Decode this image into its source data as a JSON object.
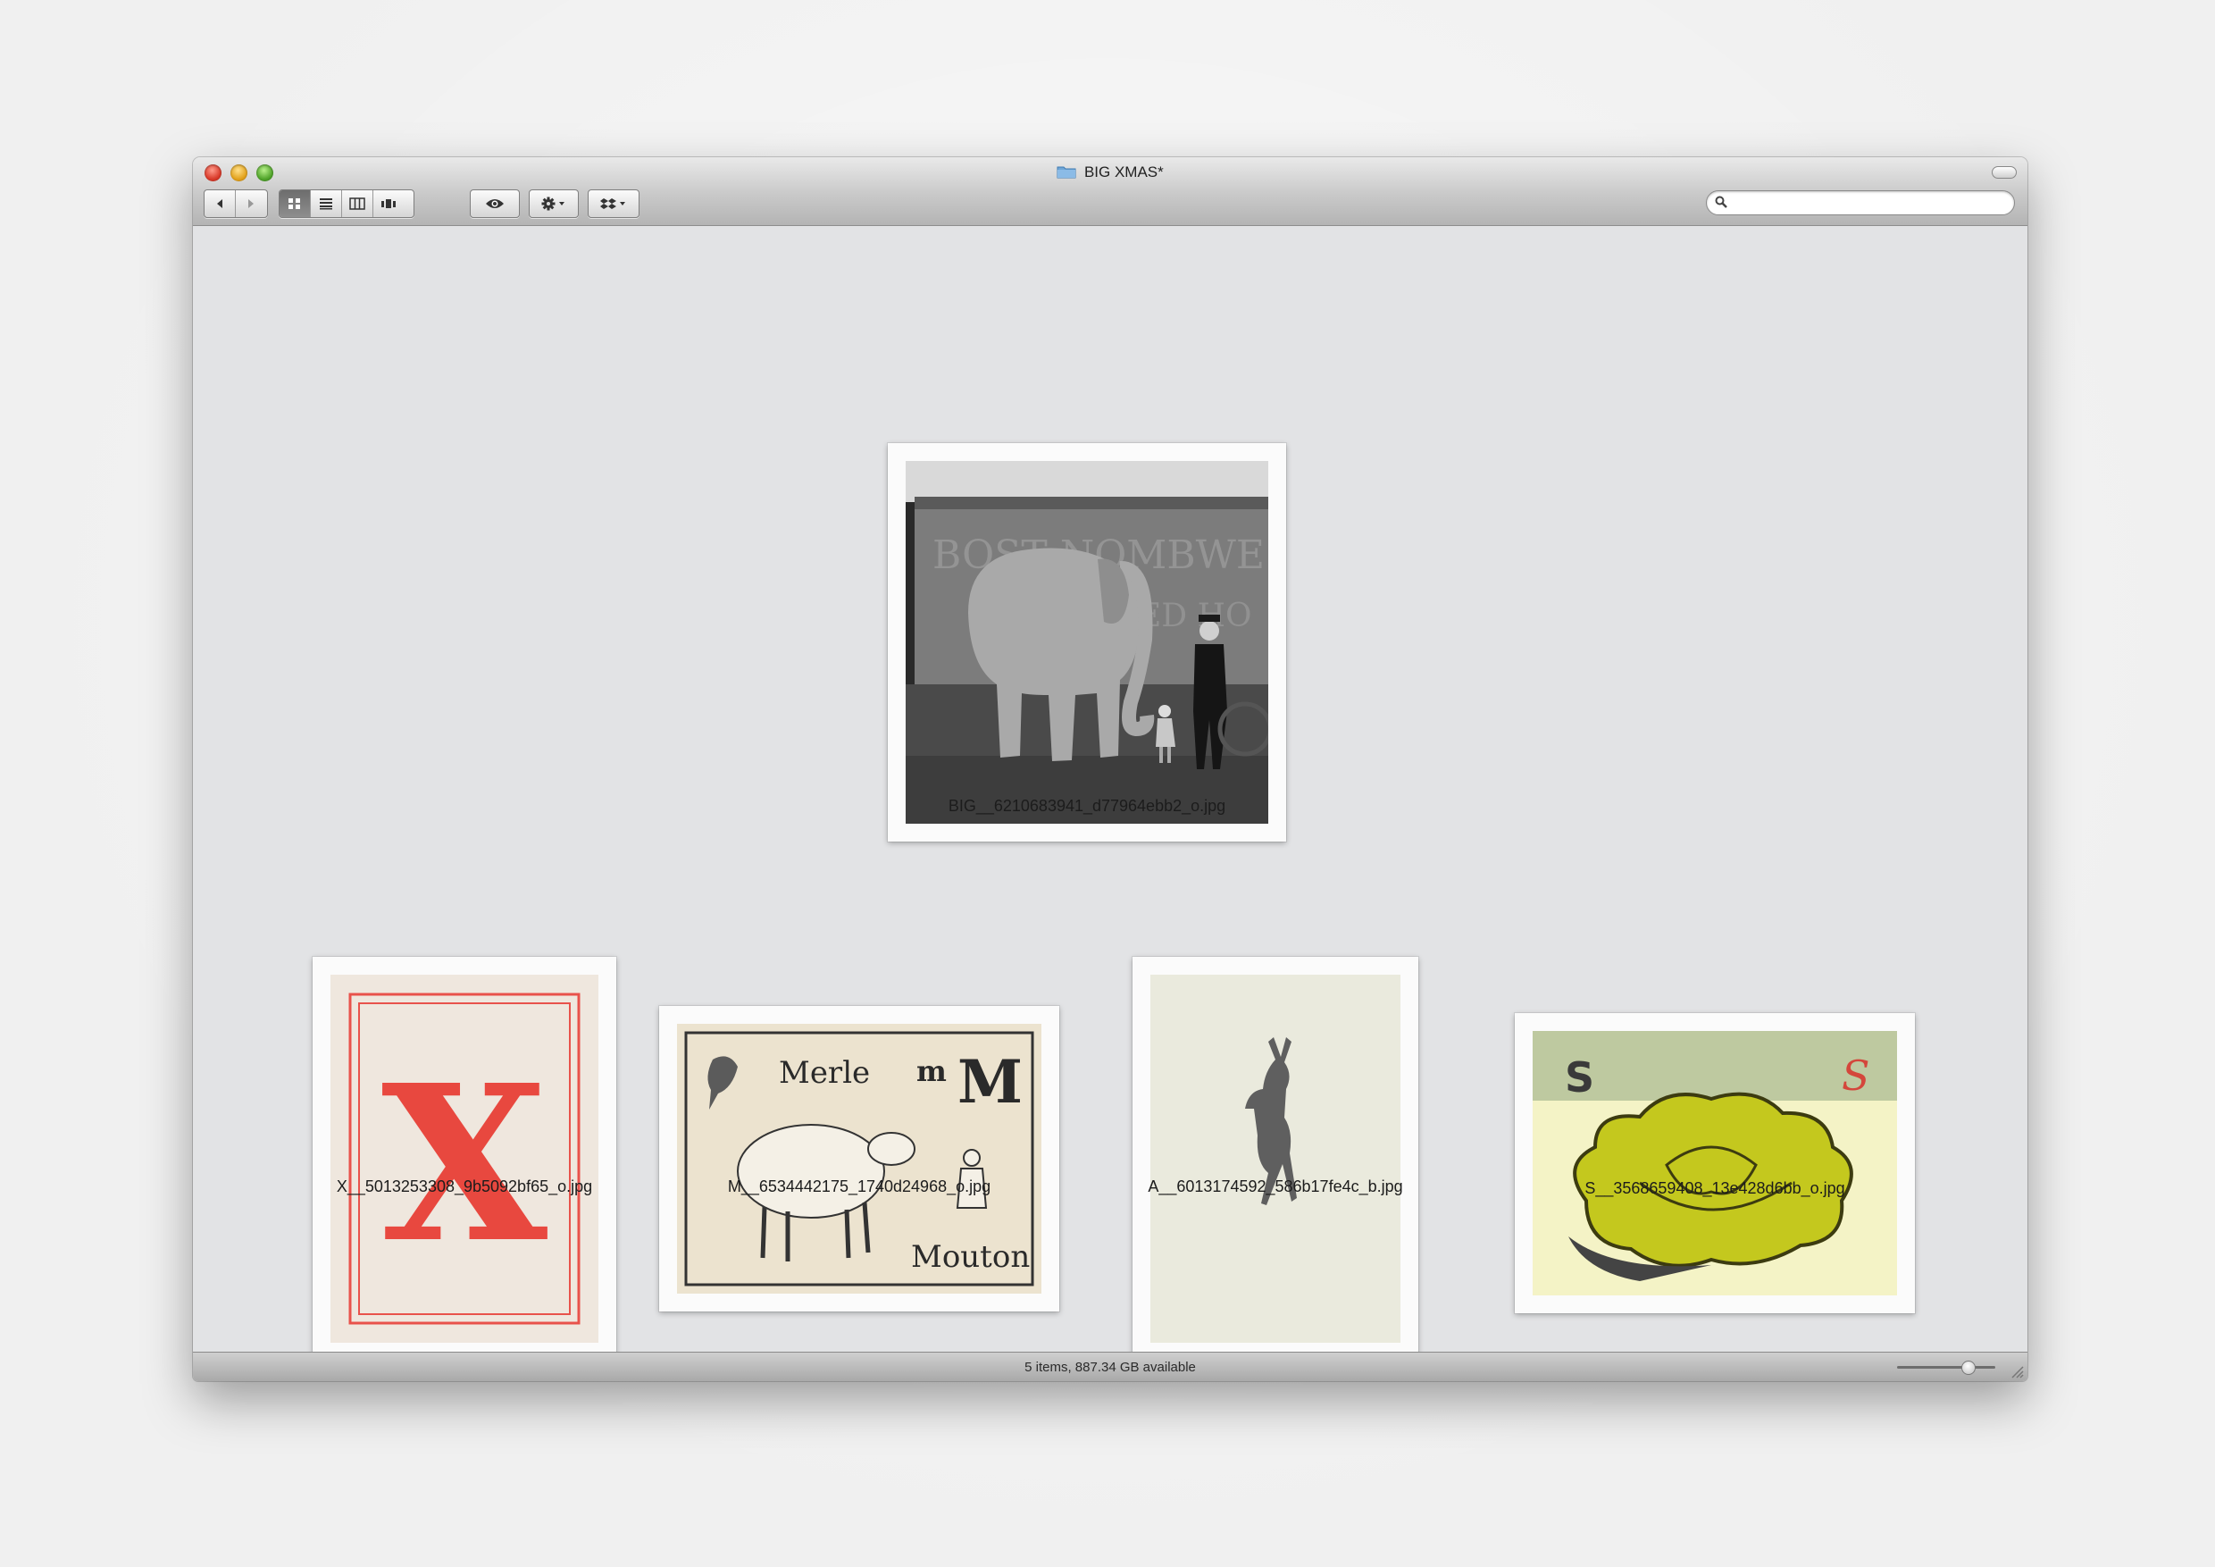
{
  "window": {
    "title": "BIG XMAS*"
  },
  "toolbar": {
    "back": "back-arrow",
    "forward": "forward-arrow",
    "views": [
      "icon-view",
      "list-view",
      "column-view",
      "cover-flow-view"
    ],
    "active_view": "icon-view",
    "quicklook": "eye",
    "action": "gear",
    "dropbox": "dropbox"
  },
  "search": {
    "placeholder": ""
  },
  "files": [
    {
      "name": "BIG__6210683941_d77964ebb2_o.jpg",
      "picture": "Vintage photo of an elephant with a man and child beside a circus wagon"
    },
    {
      "name": "X__5013253308_9b5092bf65_o.jpg",
      "picture": "Red letter X card"
    },
    {
      "name": "M__6534442175_1740d24968_o.jpg",
      "picture": "Alphabet card Merle mM Mouton"
    },
    {
      "name": "A__6013174592_586b17fe4c_b.jpg",
      "picture": "Young donkey on cream paper"
    },
    {
      "name": "S__3568659408_13e428d6bb_o.jpg",
      "picture": "Yellow-green lettuce card with letter S"
    }
  ],
  "cards": {
    "merle": "Merle",
    "small_m": "m",
    "big_m": "M",
    "mouton": "Mouton",
    "letter_x": "X",
    "letter_s": "S",
    "script_s": "S"
  },
  "status": {
    "text": "5 items, 887.34 GB available",
    "zoom": 0.72
  }
}
